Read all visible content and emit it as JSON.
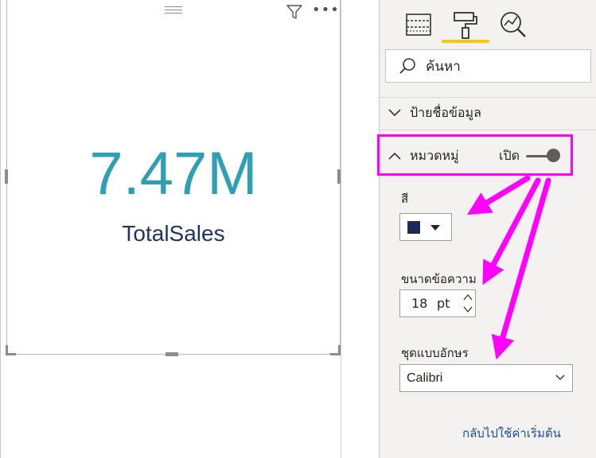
{
  "card": {
    "value": "7.47M",
    "label": "TotalSales",
    "value_color": "#2f9fb4",
    "label_color": "#1f3460",
    "toolbar_icons": [
      "drag-handle",
      "filter-icon",
      "more-options-icon"
    ]
  },
  "pane": {
    "tabs": [
      {
        "icon": "fields-icon",
        "active": false
      },
      {
        "icon": "format-paint-roller-icon",
        "active": true
      },
      {
        "icon": "analytics-icon",
        "active": false
      }
    ],
    "search_text": "ค้นหา",
    "sections": {
      "data_labels": {
        "title": "ป้ายชื่อข้อมูล",
        "expanded": false
      },
      "category": {
        "title": "หมวดหมู่",
        "expanded": true,
        "toggle_label": "เปิด",
        "toggle_on": true
      }
    },
    "category_settings": {
      "color_label": "สี",
      "color_value": "#1b2a5e",
      "text_size_label": "ขนาดข้อความ",
      "text_size_value": "18",
      "text_size_unit": "pt",
      "font_family_label": "ชุดแบบอักษร",
      "font_family_value": "Calibri"
    },
    "revert_link": "กลับไปใช้ค่าเริ่มต้น"
  },
  "annotation": {
    "highlight_color": "#ff00ff",
    "arrow_color": "#ff00ff"
  }
}
